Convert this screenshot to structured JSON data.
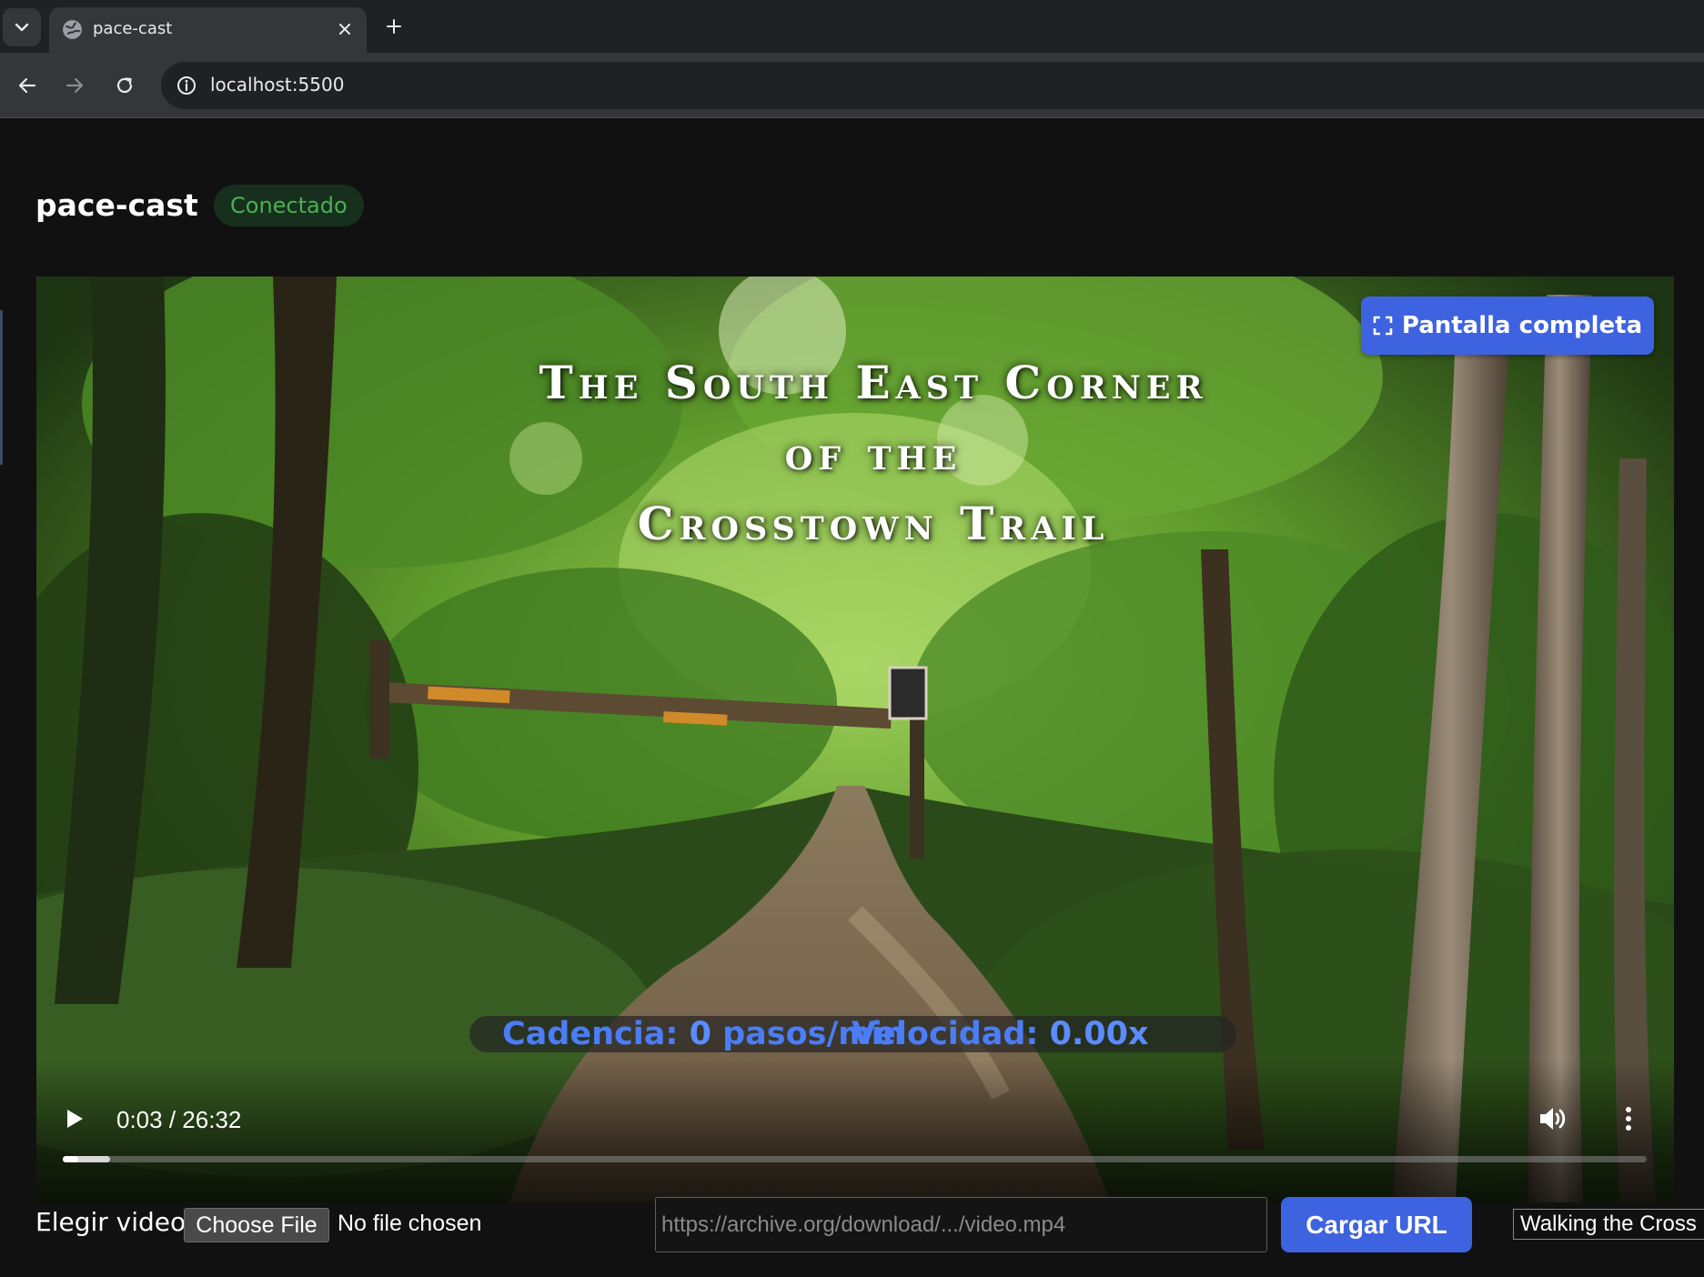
{
  "browser": {
    "tab_title": "pace-cast",
    "url": "localhost:5500"
  },
  "app": {
    "title": "pace-cast",
    "status": "Conectado",
    "colors": {
      "accent": "#3e63e0",
      "status_text": "#4caf50",
      "status_bg": "#17301d",
      "hud_text": "#4a7df7"
    }
  },
  "player": {
    "video_title_lines": [
      "The South East Corner",
      "of the",
      "Crosstown Trail"
    ],
    "fullscreen_label": "Pantalla completa",
    "hud": {
      "cadence_label": "Cadencia:",
      "cadence_value": "0",
      "cadence_unit": "pasos/min",
      "speed_label": "Velocidad:",
      "speed_value": "0.00x"
    },
    "time": "0:03 / 26:32",
    "progress_fraction": 0.0019,
    "buffered_fraction": 0.03
  },
  "bottom": {
    "file_label": "Elegir video",
    "choose_file_label": "Choose File",
    "file_status": "No file chosen",
    "url_placeholder": "https://archive.org/download/.../video.mp4",
    "url_value": "",
    "load_url_label": "Cargar URL",
    "selected_video": "Walking the Cross"
  }
}
